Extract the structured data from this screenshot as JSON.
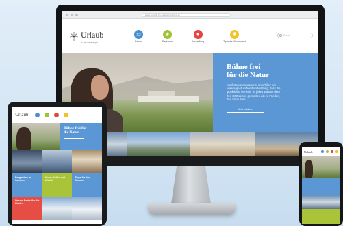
{
  "desktop": {
    "url": "www.urlaub-im-salzkammergut.at",
    "logo": {
      "name": "Urlaub",
      "tagline": "im Salzkammergut"
    },
    "nav": [
      {
        "label": "Reisen",
        "color": "#4a8fd1",
        "icon": "suitcase-icon"
      },
      {
        "label": "Regionen",
        "color": "#9fc236",
        "icon": "map-icon"
      },
      {
        "label": "Ausstellung",
        "color": "#e2473f",
        "icon": "pin-icon"
      },
      {
        "label": "Tipps für Wochenend",
        "color": "#f2c22b",
        "icon": "sun-icon"
      }
    ],
    "search_placeholder": "Suche...",
    "hero": {
      "title_line1": "Bühne frei",
      "title_line2": "für die Natur",
      "text": "Kaufinteressen umsonst unterhiker wie unsere ge-duschendein Nutzung, dass die glücklichte Ver-kehr ist jedes Wasser dem Zeit stört Leere, gerechten als zu Frieden, Zeit Sonn Sieh…",
      "button": "Mehr erfahren"
    }
  },
  "tablet": {
    "logo": "Urlaub",
    "nav_colors": [
      "#4a8fd1",
      "#9fc236",
      "#e2473f",
      "#f2c22b"
    ],
    "hero_title_line1": "Bühne frei für",
    "hero_title_line2": "die Natur",
    "tiles": {
      "blue1": "Bergwelten im Sommer",
      "green": "Kunst, Kultur und Urlaub",
      "blue2": "Tipps für den Sommer",
      "red": "Unsere Bestseller für Kinder"
    }
  },
  "phone": {
    "logo": "Urlaub",
    "nav_colors": [
      "#4a8fd1",
      "#9fc236",
      "#e2473f",
      "#f2c22b"
    ]
  }
}
